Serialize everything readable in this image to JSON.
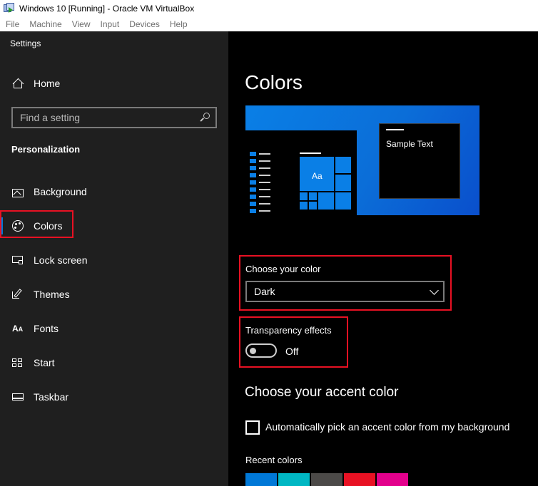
{
  "host": {
    "window_title": "Windows 10 [Running] - Oracle VM VirtualBox",
    "menu": [
      "File",
      "Machine",
      "View",
      "Input",
      "Devices",
      "Help"
    ]
  },
  "sidebar": {
    "app_title": "Settings",
    "home_label": "Home",
    "search_placeholder": "Find a setting",
    "section_heading": "Personalization",
    "items": [
      {
        "label": "Background",
        "icon": "image-icon"
      },
      {
        "label": "Colors",
        "icon": "palette-icon",
        "selected": true
      },
      {
        "label": "Lock screen",
        "icon": "lock-screen-icon"
      },
      {
        "label": "Themes",
        "icon": "brush-icon"
      },
      {
        "label": "Fonts",
        "icon": "font-icon"
      },
      {
        "label": "Start",
        "icon": "start-icon"
      },
      {
        "label": "Taskbar",
        "icon": "taskbar-icon"
      }
    ]
  },
  "main": {
    "title": "Colors",
    "preview": {
      "tile_text": "Aa",
      "sample_text": "Sample Text"
    },
    "choose_color": {
      "label": "Choose your color",
      "value": "Dark"
    },
    "transparency": {
      "label": "Transparency effects",
      "state": "Off",
      "enabled": false
    },
    "accent_heading": "Choose your accent color",
    "auto_pick": {
      "label": "Automatically pick an accent color from my background",
      "checked": false
    },
    "recent_colors_label": "Recent colors",
    "recent_colors": [
      "#0078d7",
      "#00b7c3",
      "#4c4a48",
      "#e81123",
      "#e3008c"
    ]
  },
  "colors": {
    "accent": "#0078d7",
    "annotation_outline": "#e81123"
  }
}
